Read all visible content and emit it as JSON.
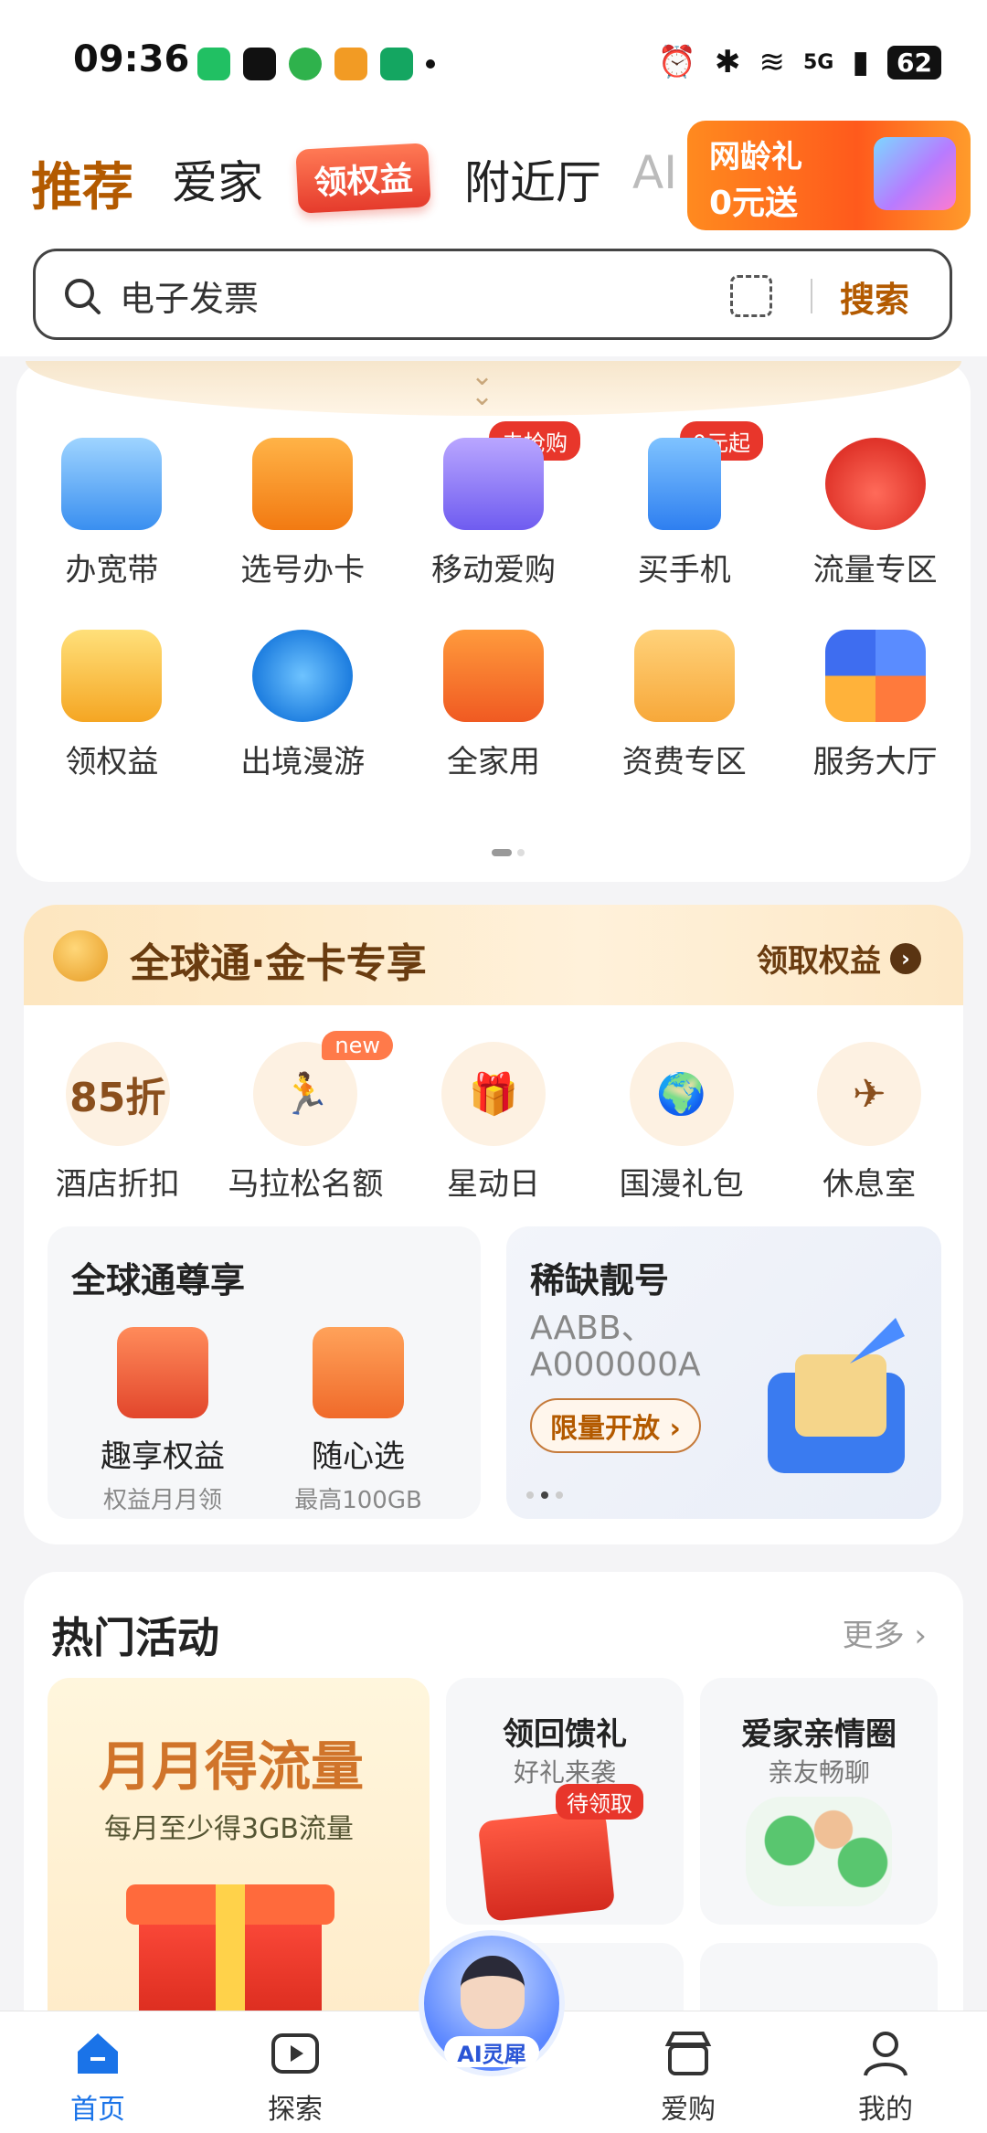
{
  "status_bar": {
    "time": "09:36",
    "network": "5G",
    "battery": "62"
  },
  "top_tabs": {
    "items": [
      "推荐",
      "爱家",
      "领权益",
      "附近厅",
      "AI"
    ],
    "promo": {
      "line1": "网龄礼",
      "line2": "0元送"
    }
  },
  "search": {
    "value": "电子发票",
    "button": "搜索"
  },
  "services": [
    {
      "label": "办宽带",
      "badge": ""
    },
    {
      "label": "选号办卡",
      "badge": ""
    },
    {
      "label": "移动爱购",
      "badge": "去抢购"
    },
    {
      "label": "买手机",
      "badge": "0元起"
    },
    {
      "label": "流量专区",
      "badge": ""
    },
    {
      "label": "领权益",
      "badge": ""
    },
    {
      "label": "出境漫游",
      "badge": ""
    },
    {
      "label": "全家用",
      "badge": ""
    },
    {
      "label": "资费专区",
      "badge": ""
    },
    {
      "label": "服务大厅",
      "badge": ""
    }
  ],
  "gold": {
    "title": "全球通·金卡专享",
    "claim": "领取权益",
    "perks": [
      {
        "label": "酒店折扣",
        "icon_text": "85折",
        "badge": ""
      },
      {
        "label": "马拉松名额",
        "icon_text": "",
        "badge": "new"
      },
      {
        "label": "星动日",
        "icon_text": "",
        "badge": ""
      },
      {
        "label": "国漫礼包",
        "icon_text": "",
        "badge": ""
      },
      {
        "label": "休息室",
        "icon_text": "",
        "badge": ""
      }
    ],
    "left_card": {
      "title": "全球通尊享",
      "items": [
        {
          "name": "趣享权益",
          "desc": "权益月月领"
        },
        {
          "name": "随心选",
          "desc": "最高100GB"
        }
      ]
    },
    "right_card": {
      "title": "稀缺靓号",
      "text": "AABB、A000000A",
      "button": "限量开放"
    }
  },
  "hot": {
    "title": "热门活动",
    "more": "更多",
    "main": {
      "title": "月月得流量",
      "sub": "每月至少得3GB流量"
    },
    "cards": [
      {
        "title": "领回馈礼",
        "sub": "好礼来袭",
        "tag": "待领取"
      },
      {
        "title": "爱家亲情圈",
        "sub": "亲友畅聊",
        "tag": ""
      }
    ]
  },
  "bottom_nav": {
    "items": [
      "首页",
      "探索",
      "爱购",
      "我的"
    ],
    "ai": "AI灵犀"
  },
  "colors": {
    "accent": "#b35a00",
    "active_nav": "#1a73e8",
    "badge_red": "#e8362b"
  }
}
